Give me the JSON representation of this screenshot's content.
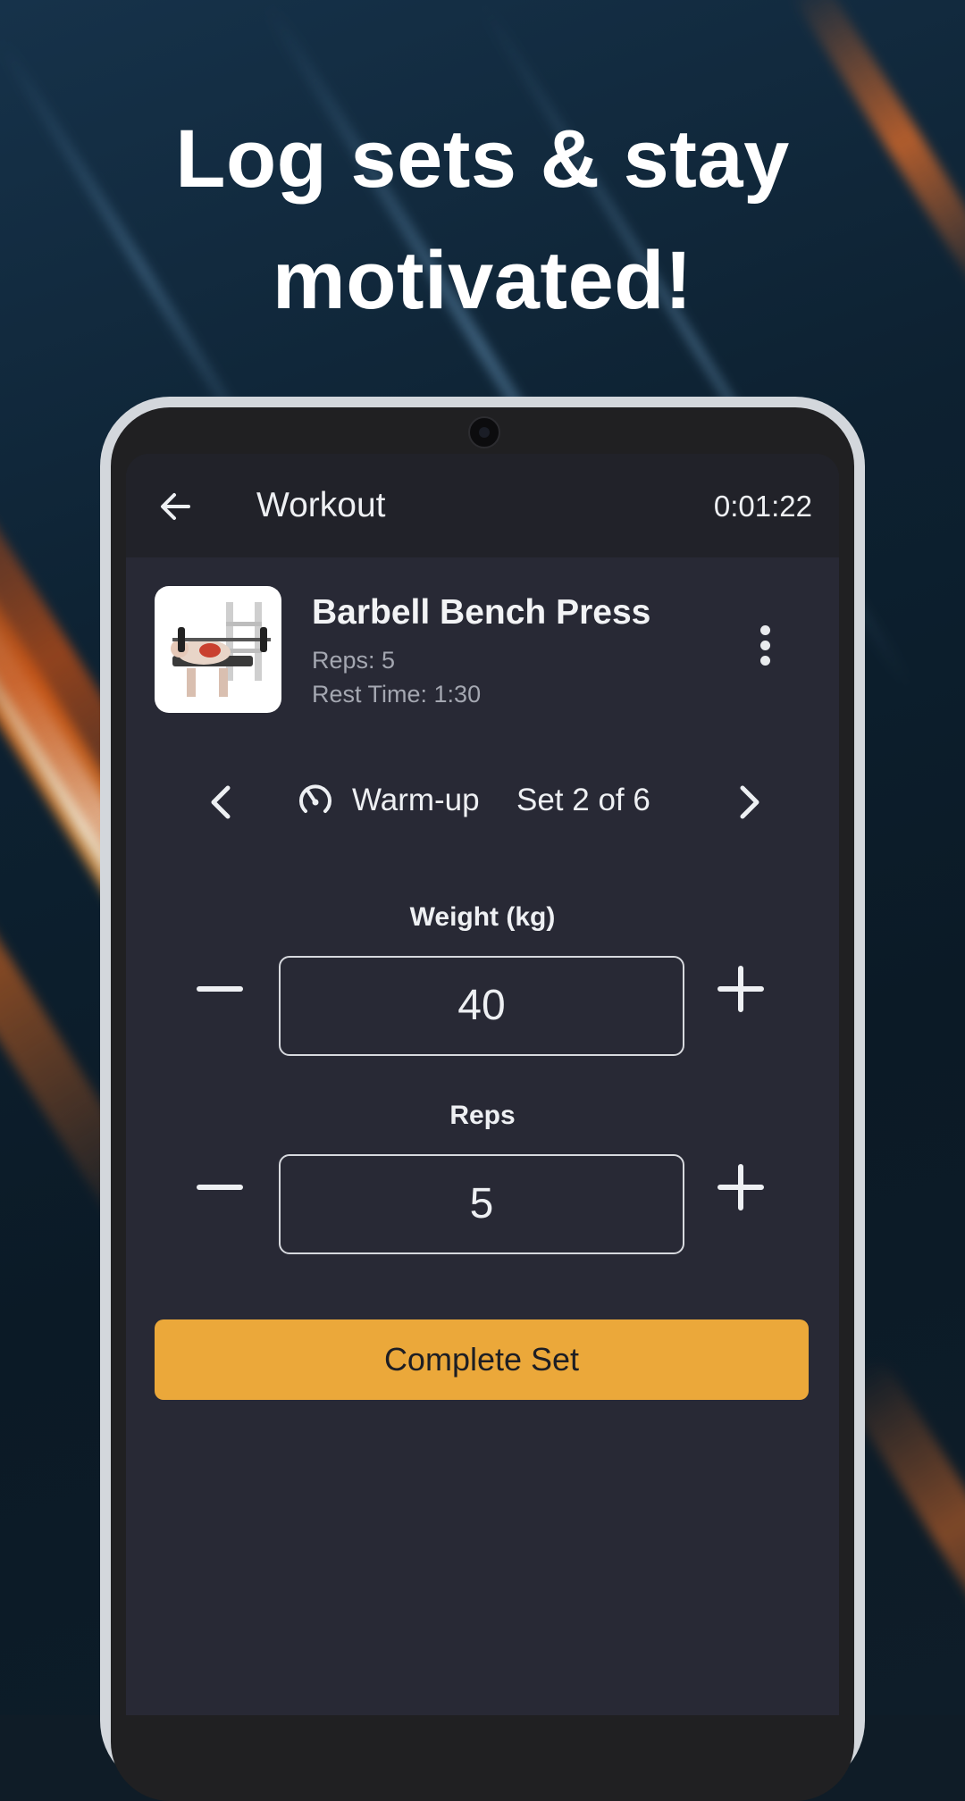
{
  "promo": {
    "headline_line1": "Log sets & stay",
    "headline_line2": "motivated!"
  },
  "appbar": {
    "title": "Workout",
    "timer": "0:01:22"
  },
  "exercise": {
    "name": "Barbell Bench Press",
    "reps": "Reps: 5",
    "rest_time": "Rest Time: 1:30"
  },
  "set_nav": {
    "type_label": "Warm-up",
    "set_label": "Set 2 of 6"
  },
  "weight": {
    "label": "Weight (kg)",
    "value": "40"
  },
  "reps": {
    "label": "Reps",
    "value": "5"
  },
  "actions": {
    "complete_label": "Complete Set"
  },
  "colors": {
    "accent": "#eba83a",
    "screen_bg": "#282935",
    "appbar_bg": "#212229"
  },
  "icons": [
    "back-arrow-icon",
    "more-vert-icon",
    "chevron-left-icon",
    "speedometer-icon",
    "chevron-right-icon",
    "minus-icon",
    "plus-icon"
  ]
}
